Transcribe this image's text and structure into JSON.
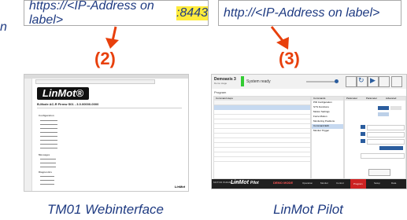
{
  "url_left": {
    "prefix": "https://<IP-Address on label>",
    "port": ":8443"
  },
  "url_right": {
    "text": "http://<IP-Address on label>"
  },
  "stray_char": "n",
  "steps": {
    "left": "(2)",
    "right": "(3)"
  },
  "captions": {
    "left": "TM01 Webinterface",
    "right": "LinMot Pilot"
  },
  "webif": {
    "logo": "LinMot®",
    "heading": "B-Mode AC-R Firmw S01 - 3.0.00000-0000",
    "sections": [
      "Configuration",
      "Messages",
      "Diagnostics"
    ],
    "footer_logo": "LinMot"
  },
  "pilot": {
    "drive_name": "Demoaxis 3",
    "drive_sub": "Demo stage",
    "status": "System ready",
    "program_label": "Program",
    "left_header": "Command steps",
    "mid_header": "Commands",
    "mid_items": [
      "PID Configuration",
      "SYS Functions",
      "Motion Settings",
      "Force Motion",
      "Monitoring Positions",
      "Command Edit",
      "Monitor Trigger"
    ],
    "tabs": [
      "Parameter",
      "Parameter",
      "Advanced"
    ],
    "brand": "LinMot",
    "brand_sub": "Pilot",
    "bottom_left": "MOTOR PARAMETERS",
    "bottom_alert": "DEMO MODE",
    "bottom_tabs": [
      "Operation",
      "Monitor",
      "Control",
      "Program",
      "Setup",
      "Data"
    ],
    "colors": {
      "status_green": "#33cc33",
      "bar": "#1f1f1f",
      "brand_red": "#cc2222",
      "accent_blue": "#2b5d9e"
    }
  },
  "arrow_color": "#e8400c"
}
